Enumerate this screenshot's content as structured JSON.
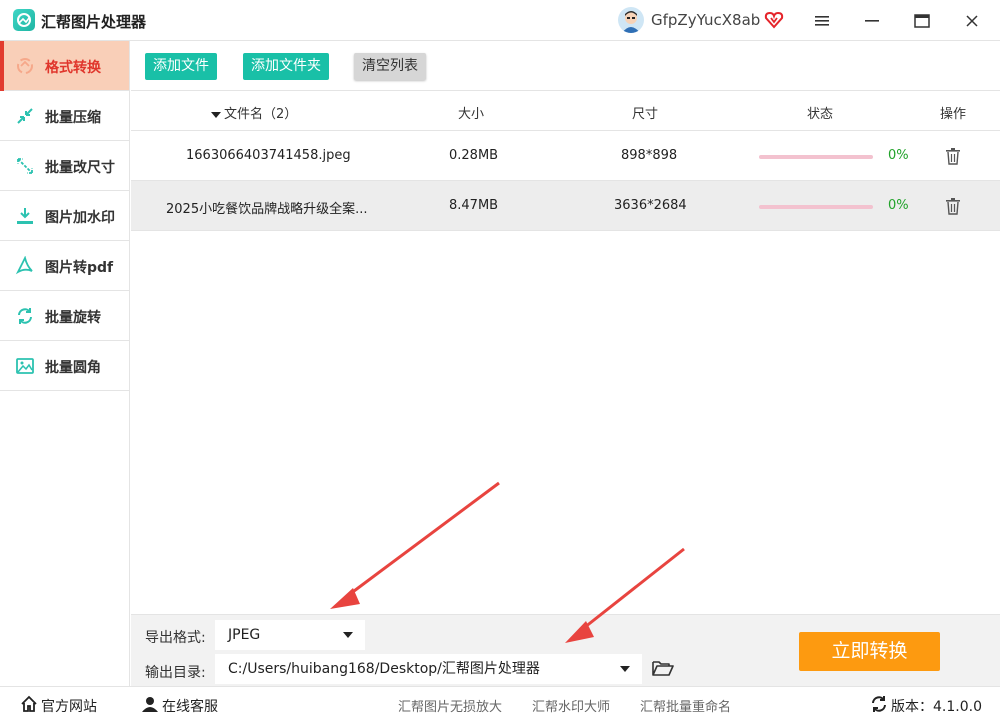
{
  "app": {
    "title": "汇帮图片处理器",
    "username": "GfpZyYucX8ab"
  },
  "sidebar": {
    "items": [
      {
        "label": "格式转换",
        "icon": "format-convert-icon",
        "active": true
      },
      {
        "label": "批量压缩",
        "icon": "compress-icon",
        "active": false
      },
      {
        "label": "批量改尺寸",
        "icon": "resize-icon",
        "active": false
      },
      {
        "label": "图片加水印",
        "icon": "watermark-icon",
        "active": false
      },
      {
        "label": "图片转pdf",
        "icon": "pdf-icon",
        "active": false
      },
      {
        "label": "批量旋转",
        "icon": "rotate-icon",
        "active": false
      },
      {
        "label": "批量圆角",
        "icon": "rounded-corner-icon",
        "active": false
      }
    ]
  },
  "toolbar": {
    "add_file": "添加文件",
    "add_folder": "添加文件夹",
    "clear_list": "清空列表"
  },
  "table": {
    "headers": {
      "name": "文件名（2）",
      "size": "大小",
      "dimensions": "尺寸",
      "status": "状态",
      "action": "操作"
    },
    "rows": [
      {
        "name": "1663066403741458.jpeg",
        "size": "0.28MB",
        "dimensions": "898*898",
        "progress": "0%"
      },
      {
        "name": "2025小吃餐饮品牌战略升级全案...",
        "size": "8.47MB",
        "dimensions": "3636*2684",
        "progress": "0%"
      }
    ]
  },
  "settings": {
    "format_label": "导出格式:",
    "format_value": "JPEG",
    "dir_label": "输出目录:",
    "dir_value": "C:/Users/huibang168/Desktop/汇帮图片处理器",
    "convert_button": "立即转换"
  },
  "statusbar": {
    "website": "官方网站",
    "support": "在线客服",
    "links": [
      "汇帮图片无损放大",
      "汇帮水印大师",
      "汇帮批量重命名"
    ],
    "version": "版本：4.1.0.0"
  },
  "colors": {
    "accent": "#19c0a7",
    "active_bg": "#f9cfb8",
    "active_text": "#e0362c",
    "convert": "#fd9a10",
    "arrow": "#e8443f"
  }
}
